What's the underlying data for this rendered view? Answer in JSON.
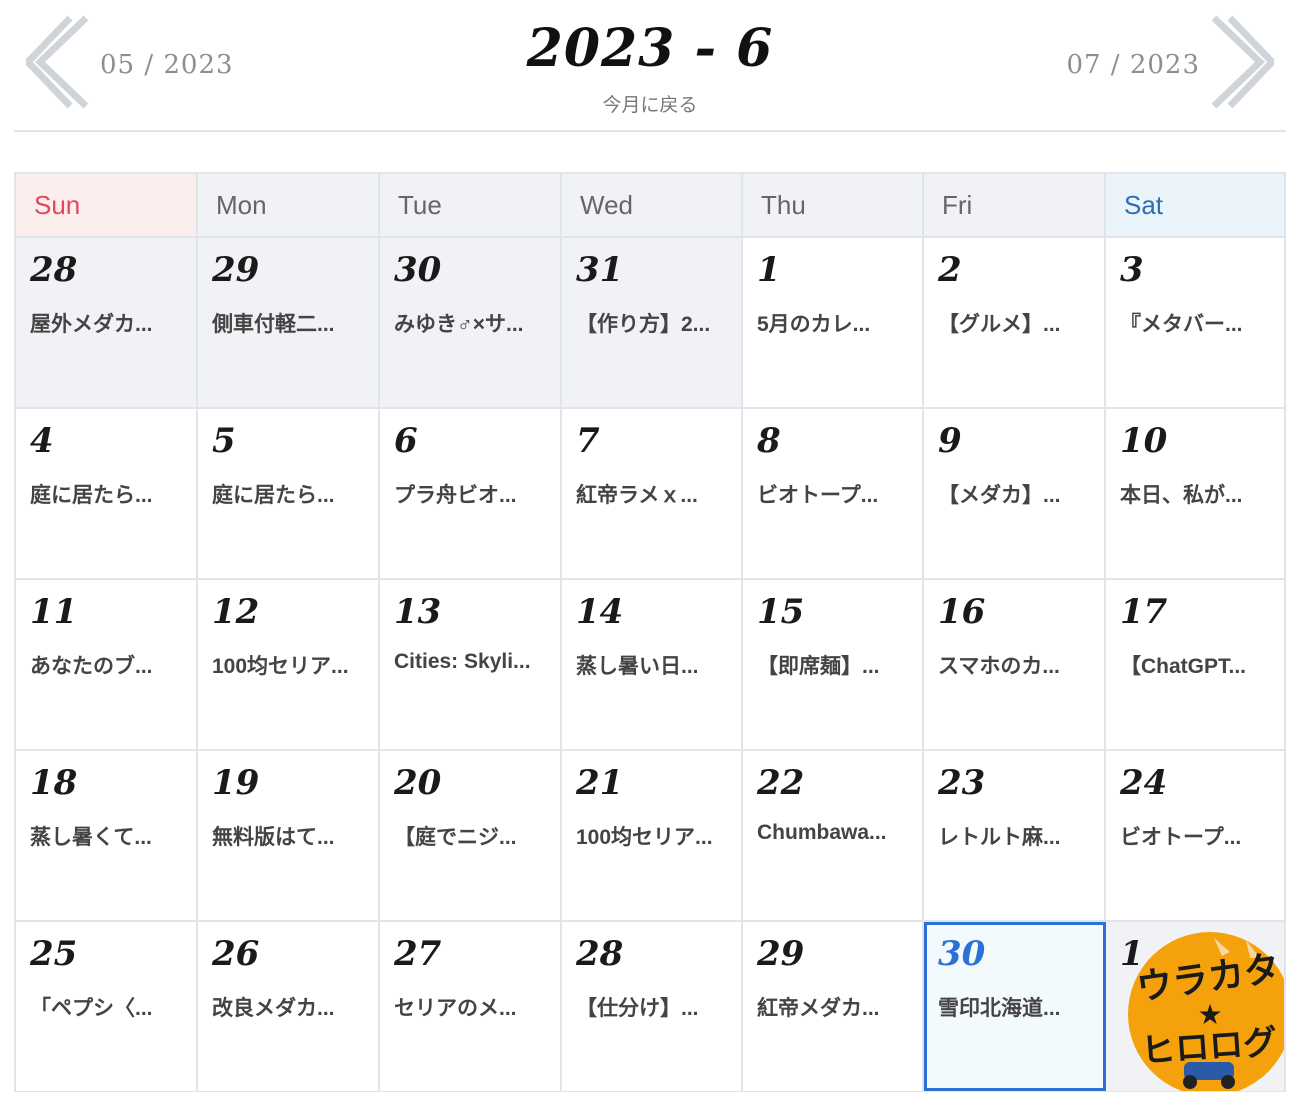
{
  "header": {
    "title": "2023 - 6",
    "back_label": "今月に戻る",
    "prev_label": "05 / 2023",
    "next_label": "07 / 2023"
  },
  "weekdays": [
    "Sun",
    "Mon",
    "Tue",
    "Wed",
    "Thu",
    "Fri",
    "Sat"
  ],
  "weeks": [
    [
      {
        "day": "28",
        "post": "屋外メダカ..."
      },
      {
        "day": "29",
        "post": "側車付軽二..."
      },
      {
        "day": "30",
        "post": "みゆき♂×サ..."
      },
      {
        "day": "31",
        "post": "【作り方】2..."
      },
      {
        "day": "1",
        "post": "5月のカレ..."
      },
      {
        "day": "2",
        "post": "【グルメ】..."
      },
      {
        "day": "3",
        "post": "『メタバー..."
      }
    ],
    [
      {
        "day": "4",
        "post": "庭に居たら..."
      },
      {
        "day": "5",
        "post": "庭に居たら..."
      },
      {
        "day": "6",
        "post": "プラ舟ビオ..."
      },
      {
        "day": "7",
        "post": "紅帝ラメｘ..."
      },
      {
        "day": "8",
        "post": "ビオトープ..."
      },
      {
        "day": "9",
        "post": "【メダカ】..."
      },
      {
        "day": "10",
        "post": "本日、私が..."
      }
    ],
    [
      {
        "day": "11",
        "post": "あなたのブ..."
      },
      {
        "day": "12",
        "post": "100均セリア..."
      },
      {
        "day": "13",
        "post": "Cities: Skyli..."
      },
      {
        "day": "14",
        "post": "蒸し暑い日..."
      },
      {
        "day": "15",
        "post": "【即席麺】..."
      },
      {
        "day": "16",
        "post": "スマホのカ..."
      },
      {
        "day": "17",
        "post": "【ChatGPT..."
      }
    ],
    [
      {
        "day": "18",
        "post": "蒸し暑くて..."
      },
      {
        "day": "19",
        "post": "無料版はて..."
      },
      {
        "day": "20",
        "post": "【庭でニジ..."
      },
      {
        "day": "21",
        "post": "100均セリア..."
      },
      {
        "day": "22",
        "post": "Chumbawa..."
      },
      {
        "day": "23",
        "post": "レトルト麻..."
      },
      {
        "day": "24",
        "post": "ビオトープ..."
      }
    ],
    [
      {
        "day": "25",
        "post": "「ペプシ〈..."
      },
      {
        "day": "26",
        "post": "改良メダカ..."
      },
      {
        "day": "27",
        "post": "セリアのメ..."
      },
      {
        "day": "28",
        "post": "【仕分け】..."
      },
      {
        "day": "29",
        "post": "紅帝メダカ..."
      },
      {
        "day": "30",
        "post": "雪印北海道..."
      },
      {
        "day": "1",
        "post": ""
      }
    ]
  ],
  "logo": {
    "line1": "ウラカタ",
    "star": "★",
    "line2": "ヒロログ"
  },
  "colors": {
    "sunday": "#e3475a",
    "saturday": "#2c6fb4",
    "today_border": "#2b72d8",
    "logo_orange": "#f5a10c"
  }
}
